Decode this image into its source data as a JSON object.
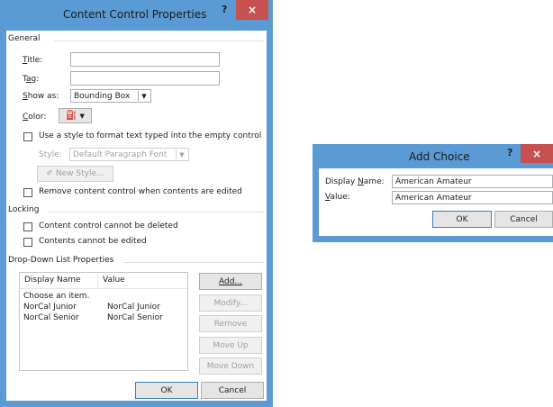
{
  "content_control_dialog": {
    "title": "Content Control Properties",
    "help_glyph": "?",
    "close_glyph": "×",
    "general": {
      "group_label": "General",
      "title_label": "Title:",
      "title_value": "",
      "tag_label": "Tag:",
      "tag_value": "",
      "show_as_label": "Show as:",
      "show_as_value": "Bounding Box",
      "color_label": "Color:",
      "use_style_label": "Use a style to format text typed into the empty control",
      "use_style_checked": false,
      "style_label": "Style:",
      "style_value": "Default Paragraph Font",
      "new_style_label": "New Style...",
      "remove_label": "Remove content control when contents are edited",
      "remove_checked": false
    },
    "locking": {
      "group_label": "Locking",
      "cannot_delete_label": "Content control cannot be deleted",
      "cannot_delete_checked": false,
      "cannot_edit_label": "Contents cannot be edited",
      "cannot_edit_checked": false
    },
    "dropdown": {
      "group_label": "Drop-Down List Properties",
      "columns": [
        "Display Name",
        "Value"
      ],
      "rows": [
        {
          "display": "Choose an item.",
          "value": ""
        },
        {
          "display": "NorCal Junior",
          "value": "NorCal Junior"
        },
        {
          "display": "NorCal Senior",
          "value": "NorCal Senior"
        }
      ],
      "buttons": {
        "add": "Add...",
        "modify": "Modify...",
        "remove": "Remove",
        "move_up": "Move Up",
        "move_down": "Move Down"
      }
    },
    "ok_label": "OK",
    "cancel_label": "Cancel"
  },
  "add_choice_dialog": {
    "title": "Add Choice",
    "help_glyph": "?",
    "close_glyph": "×",
    "display_name_label": "Display Name:",
    "display_name_value": "American Amateur",
    "value_label": "Value:",
    "value_value": "American Amateur",
    "ok_label": "OK",
    "cancel_label": "Cancel"
  },
  "colors": {
    "frame": "#5b9bd5",
    "close_button": "#c75050"
  }
}
